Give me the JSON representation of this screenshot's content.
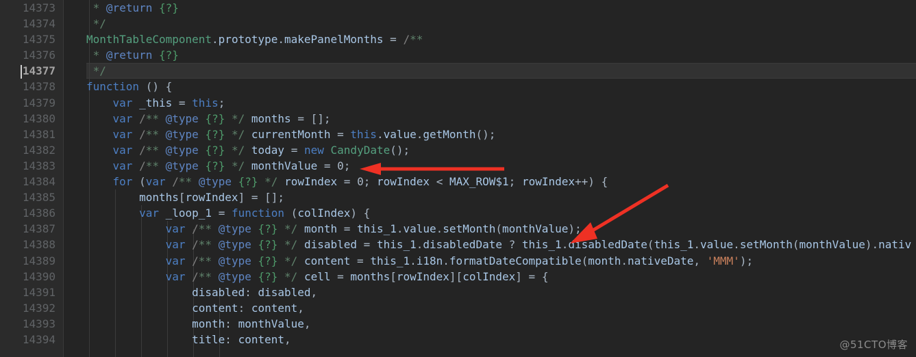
{
  "editor": {
    "theme_name": "darcula",
    "background": "#242424",
    "gutter_background": "#2b2b2b",
    "active_line_background": "#323232",
    "active_line_number": "14377",
    "caret_line": "14377",
    "language": "JavaScript"
  },
  "gutter": {
    "line_numbers": [
      "14373",
      "14374",
      "14375",
      "14376",
      "14377",
      "14378",
      "14379",
      "14380",
      "14381",
      "14382",
      "14383",
      "14384",
      "14385",
      "14386",
      "14387",
      "14388",
      "14389",
      "14390",
      "14391",
      "14392",
      "14393",
      "14394"
    ]
  },
  "code": {
    "lines": [
      {
        "n": "14373",
        "text": " * @return {?}"
      },
      {
        "n": "14374",
        "text": " */"
      },
      {
        "n": "14375",
        "text": "MonthTableComponent.prototype.makePanelMonths = /**"
      },
      {
        "n": "14376",
        "text": " * @return {?}"
      },
      {
        "n": "14377",
        "text": " */"
      },
      {
        "n": "14378",
        "text": "function () {"
      },
      {
        "n": "14379",
        "text": "    var _this = this;"
      },
      {
        "n": "14380",
        "text": "    var /** @type {?} */ months = [];"
      },
      {
        "n": "14381",
        "text": "    var /** @type {?} */ currentMonth = this.value.getMonth();"
      },
      {
        "n": "14382",
        "text": "    var /** @type {?} */ today = new CandyDate();"
      },
      {
        "n": "14383",
        "text": "    var /** @type {?} */ monthValue = 0;"
      },
      {
        "n": "14384",
        "text": "    for (var /** @type {?} */ rowIndex = 0; rowIndex < MAX_ROW$1; rowIndex++) {"
      },
      {
        "n": "14385",
        "text": "        months[rowIndex] = [];"
      },
      {
        "n": "14386",
        "text": "        var _loop_1 = function (colIndex) {"
      },
      {
        "n": "14387",
        "text": "            var /** @type {?} */ month = this_1.value.setMonth(monthValue);"
      },
      {
        "n": "14388",
        "text": "            var /** @type {?} */ disabled = this_1.disabledDate ? this_1.disabledDate(this_1.value.setMonth(monthValue).nativ"
      },
      {
        "n": "14389",
        "text": "            var /** @type {?} */ content = this_1.i18n.formatDateCompatible(month.nativeDate, 'MMM');"
      },
      {
        "n": "14390",
        "text": "            var /** @type {?} */ cell = months[rowIndex][colIndex] = {"
      },
      {
        "n": "14391",
        "text": "                disabled: disabled,"
      },
      {
        "n": "14392",
        "text": "                content: content,"
      },
      {
        "n": "14393",
        "text": "                month: monthValue,"
      },
      {
        "n": "14394",
        "text": "                title: content,"
      }
    ]
  },
  "annotations": {
    "arrow_color": "#ee3124",
    "arrows": [
      {
        "name": "arrow-to-monthvalue-assignment",
        "target_text": "monthValue = 0;",
        "target_line": "14383"
      },
      {
        "name": "arrow-to-setmonth-monthvalue",
        "target_text": "setMonth(monthValue)",
        "target_line": "14387"
      }
    ]
  },
  "watermark": {
    "text": "@51CTO博客"
  }
}
